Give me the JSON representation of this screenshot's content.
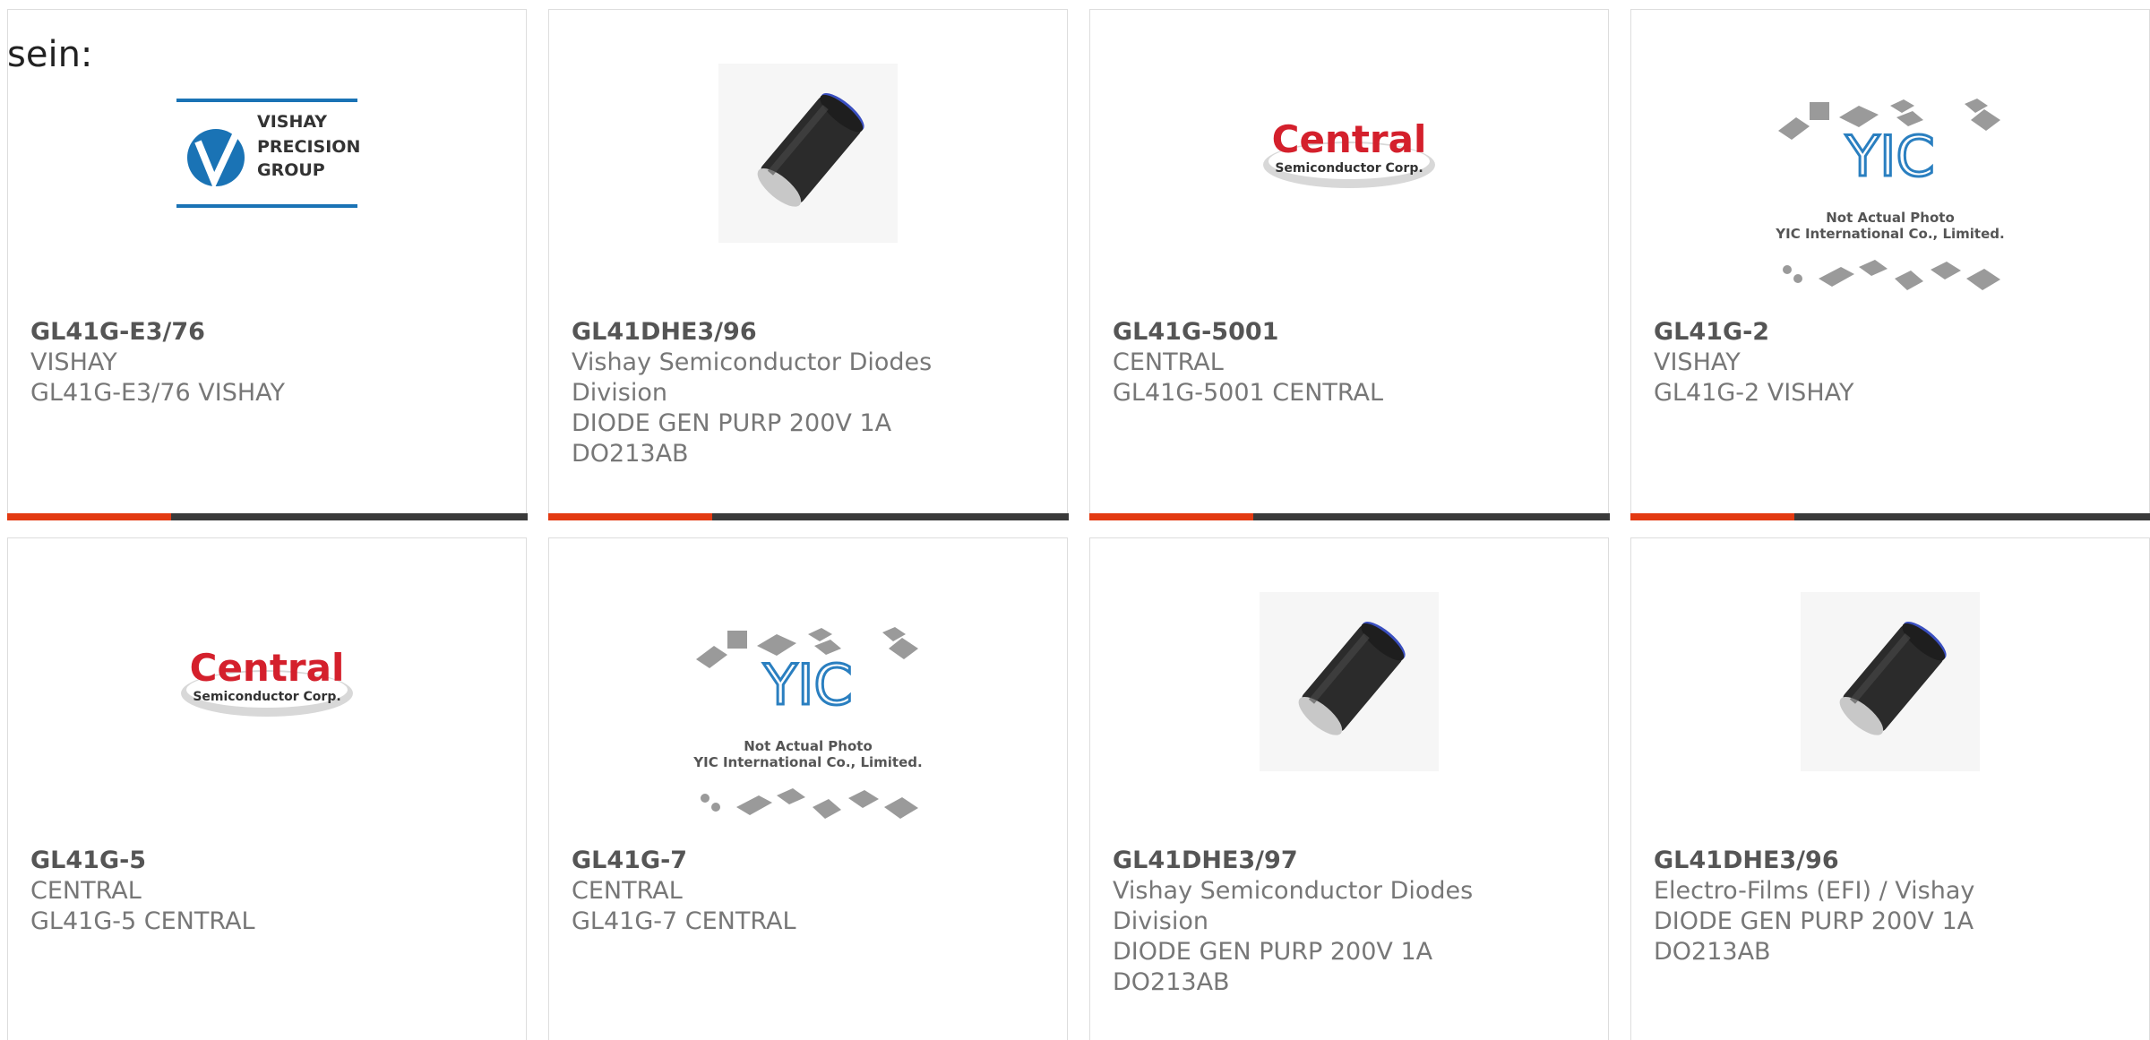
{
  "intro_text": "sein:",
  "products": [
    {
      "part_number": "GL41G-E3/76",
      "lines": [
        "VISHAY",
        "GL41G-E3/76 VISHAY"
      ],
      "image": "vishay-logo",
      "logo_text": [
        "VISHAY",
        "PRECISION",
        "GROUP"
      ]
    },
    {
      "part_number": "GL41DHE3/96",
      "lines": [
        "Vishay Semiconductor Diodes",
        "Division",
        "DIODE GEN PURP 200V 1A",
        "DO213AB"
      ],
      "image": "diode-cylinder-photo"
    },
    {
      "part_number": "GL41G-5001",
      "lines": [
        "CENTRAL",
        "GL41G-5001 CENTRAL"
      ],
      "image": "central-logo",
      "logo_text": [
        "Central",
        "Semiconductor Corp."
      ]
    },
    {
      "part_number": "GL41G-2",
      "lines": [
        "VISHAY",
        "GL41G-2 VISHAY"
      ],
      "image": "yic-placeholder",
      "logo_text": [
        "YIC",
        "Not Actual Photo",
        "YIC International Co., Limited."
      ]
    },
    {
      "part_number": "GL41G-5",
      "lines": [
        "CENTRAL",
        "GL41G-5 CENTRAL"
      ],
      "image": "central-logo",
      "logo_text": [
        "Central",
        "Semiconductor Corp."
      ]
    },
    {
      "part_number": "GL41G-7",
      "lines": [
        "CENTRAL",
        "GL41G-7 CENTRAL"
      ],
      "image": "yic-placeholder",
      "logo_text": [
        "YIC",
        "Not Actual Photo",
        "YIC International Co., Limited."
      ]
    },
    {
      "part_number": "GL41DHE3/97",
      "lines": [
        "Vishay Semiconductor Diodes",
        "Division",
        "DIODE GEN PURP 200V 1A",
        "DO213AB"
      ],
      "image": "diode-cylinder-photo"
    },
    {
      "part_number": "GL41DHE3/96",
      "lines": [
        "Electro-Films (EFI) / Vishay",
        "DIODE GEN PURP 200V 1A",
        "DO213AB"
      ],
      "image": "diode-cylinder-photo"
    }
  ],
  "colors": {
    "accent_bar": "#e33a12",
    "dark_bar": "#3a3a3a",
    "vishay_blue": "#1a73b5",
    "central_red": "#d4202c",
    "yic_blue": "#2a7fc0"
  }
}
